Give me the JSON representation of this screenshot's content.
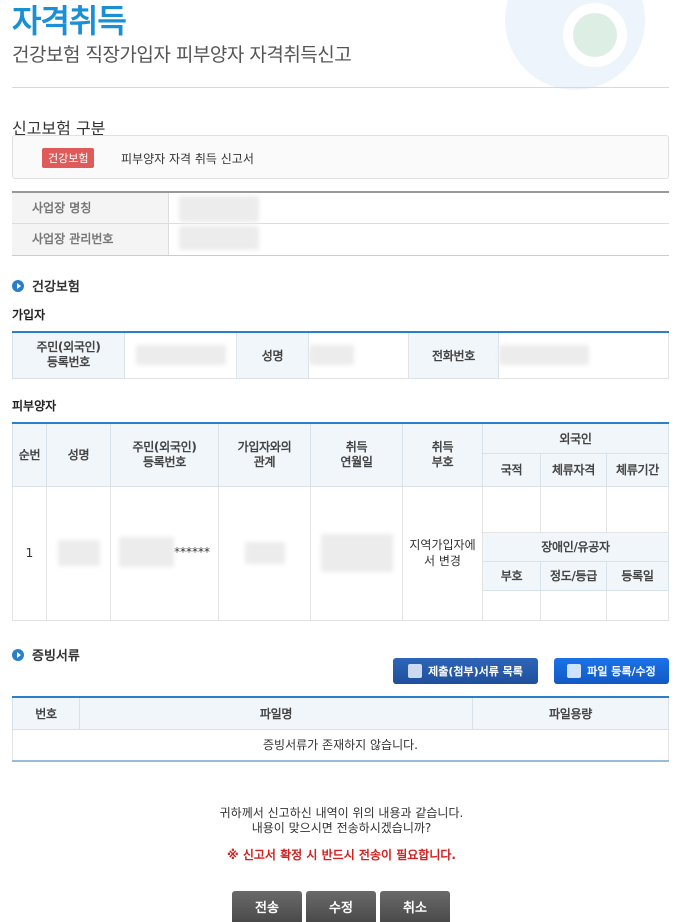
{
  "header": {
    "title": "자격취득",
    "subtitle": "건강보험 직장가입자 피부양자 자격취득신고"
  },
  "section": {
    "title": "신고보험 구분",
    "badge": "건강보험",
    "category_text": "피부양자 자격 취득 신고서"
  },
  "business": {
    "name_label": "사업장 명칭",
    "mgmt_label": "사업장 관리번호"
  },
  "health": {
    "heading": "건강보험",
    "subscriber_heading": "가입자",
    "subscriber_cols": {
      "rrn": "주민(외국인)\n등록번호",
      "name": "성명",
      "phone": "전화번호"
    },
    "dependent_heading": "피부양자",
    "dependent_cols": {
      "seq": "순번",
      "name": "성명",
      "rrn": "주민(외국인)\n등록번호",
      "relation": "가입자와의\n관계",
      "acq_date": "취득\n연월일",
      "acq_code": "취득\n부호",
      "foreigner": "외국인",
      "nationality": "국적",
      "stay_status": "체류자격",
      "stay_period": "체류기간",
      "disability": "장애인/유공자",
      "code": "부호",
      "grade": "정도/등급",
      "reg_date": "등록일"
    },
    "dependent_row": {
      "seq": "1",
      "rrn_suffix": "******",
      "acq_code": "지역가입자에서 변경"
    }
  },
  "evidence": {
    "heading": "증빙서류",
    "btn_list": "제출(첨부)서류 목록",
    "btn_upload": "파일 등록/수정",
    "cols": {
      "no": "번호",
      "file": "파일명",
      "size": "파일용량"
    },
    "empty": "증빙서류가 존재하지 않습니다."
  },
  "confirm": {
    "line1": "귀하께서 신고하신 내역이 위의 내용과 같습니다.",
    "line2": "내용이 맞으시면 전송하시겠습니까?",
    "warning": "※ 신고서 확정 시 반드시 전송이 필요합니다."
  },
  "buttons": {
    "send": "전송",
    "edit": "수정",
    "cancel": "취소"
  },
  "colors": {
    "accent": "#1a8fd6",
    "warning": "#d32020",
    "badge": "#e05a5a",
    "button_blue": "#1e4f9c"
  }
}
